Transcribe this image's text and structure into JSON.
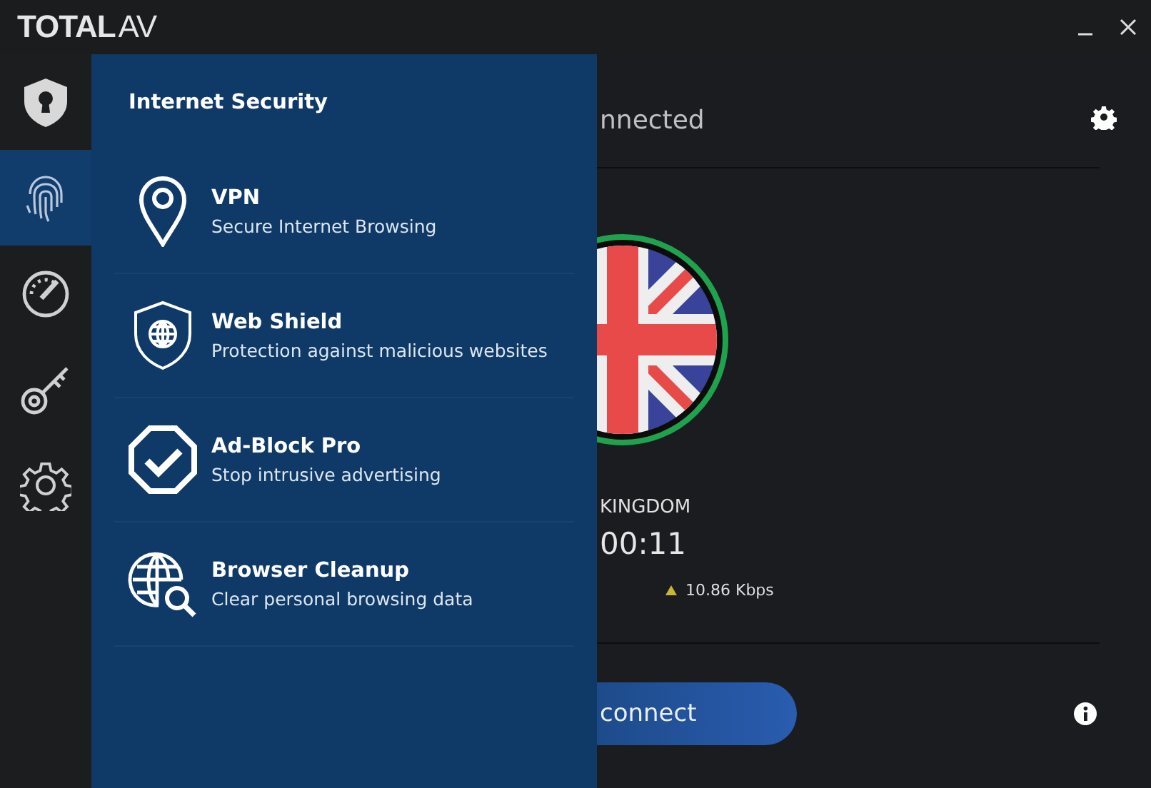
{
  "logo": {
    "bold": "TOTAL",
    "light": "AV"
  },
  "sidebar": {
    "items": [
      {
        "kind": "shield",
        "selected": false
      },
      {
        "kind": "fingerprint",
        "selected": true
      },
      {
        "kind": "gauge",
        "selected": false
      },
      {
        "kind": "key",
        "selected": false
      },
      {
        "kind": "gear",
        "selected": false
      }
    ]
  },
  "flyout": {
    "title": "Internet Security",
    "items": [
      {
        "kind": "pin",
        "title": "VPN",
        "subtitle": "Secure Internet Browsing"
      },
      {
        "kind": "shield-globe",
        "title": "Web Shield",
        "subtitle": "Protection against malicious websites"
      },
      {
        "kind": "check",
        "title": "Ad-Block Pro",
        "subtitle": "Stop intrusive advertising"
      },
      {
        "kind": "globe-search",
        "title": "Browser Cleanup",
        "subtitle": "Clear personal browsing data"
      }
    ]
  },
  "vpn": {
    "status": "nnected",
    "country": "KINGDOM",
    "timer": "00:11",
    "upload_speed": "10.86 Kbps",
    "button": "connect"
  }
}
